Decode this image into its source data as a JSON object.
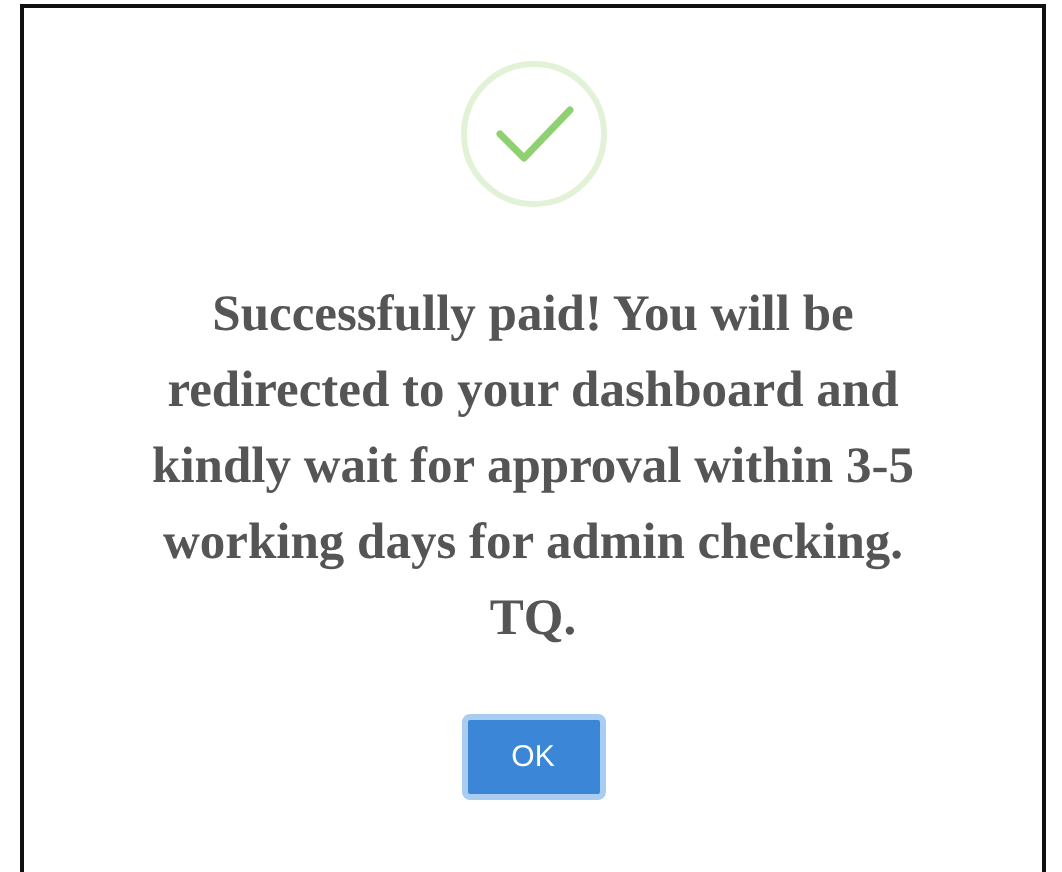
{
  "dialog": {
    "message": "Successfully paid! You will be redirected to your dashboard and kindly wait for approval within 3-5 working days for admin checking. TQ.",
    "buttons": [
      "OK"
    ]
  }
}
